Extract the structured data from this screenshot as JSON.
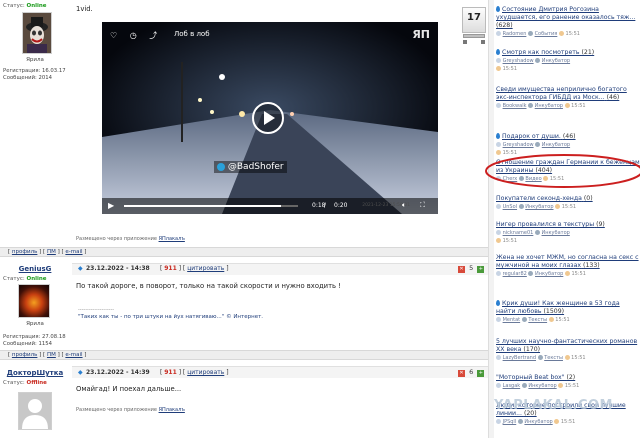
{
  "posts": [
    {
      "status_label": "Статус:",
      "status_value": "Online",
      "rank": "Ярила",
      "reg_label": "Регистрация:",
      "reg_date": "16.03.17",
      "msg_label": "Сообщений:",
      "msg_count": "2014",
      "body": "1vid.",
      "vote_count": "17",
      "via_text": "Размещено через приложение",
      "via_app": "ЯПлакалъ"
    },
    {
      "username": "GeniusG",
      "status_label": "Статус:",
      "status_value": "Online",
      "rank": "Ярила",
      "reg_label": "Регистрация:",
      "reg_date": "27.08.18",
      "msg_label": "Сообщений:",
      "msg_count": "1154",
      "date": "23.12.2022 - 14:38",
      "rating": "911",
      "quote": "цитировать",
      "score": "5",
      "body": "По такой дороге, в поворот, только на такой скорости и нужно входить !",
      "separator": "--------------------",
      "sig": "\"Таких как ты - по три штуки на йух натягиваю...\" © Интернет."
    },
    {
      "username": "ДокторШутка",
      "status_label": "Статус:",
      "status_value": "Offline",
      "date": "23.12.2022 - 14:39",
      "rating": "911",
      "quote": "цитировать",
      "score": "6",
      "body": "Омайгад! И поехал дальше...",
      "via_text": "Размещено через приложение",
      "via_app": "ЯПлакалъ"
    }
  ],
  "footer_links": [
    "профиль",
    "ПМ",
    "e-mail"
  ],
  "video": {
    "title": "Лоб в лоб",
    "logo": "ЯП",
    "channel": "@BadShofer",
    "time_current": "0:18",
    "time_total": "0:20",
    "timestamp": "2021-12-23 15:58:01"
  },
  "sidebar": [
    {
      "title": "Состояние Дмитрия Рогозина ухудшается, его ранение оказалось тяж...",
      "count": "(628)",
      "user": "Radomen",
      "category": "События",
      "time": "15:51",
      "drop": true
    },
    {
      "title": "Смотря как посмотреть",
      "count": "(21)",
      "user": "Greyshadow",
      "category": "Инкубатор",
      "time": "15:51",
      "drop": true
    },
    {
      "title": "Сведи имущества неприлично богатого экс-инспектора ГИБДД из Моск...",
      "count": "(46)",
      "user": "Bookwalk",
      "category": "Инкубатор",
      "time": "15:51",
      "drop": false
    },
    {
      "title": "Подарок от души.",
      "count": "(46)",
      "user": "Greyshadow",
      "category": "Инкубатор",
      "time": "15:51",
      "drop": true
    },
    {
      "title": "Отношение граждан Германии к беженцам из Украины",
      "count": "(404)",
      "user": "Cherx",
      "category": "Видео",
      "time": "15:51",
      "drop": false
    },
    {
      "title": "Покупатели секонд-хенда",
      "count": "(0)",
      "user": "UnSol",
      "category": "Инкубатор",
      "time": "15:51",
      "drop": false
    },
    {
      "title": "Нигер провалился в текстуры",
      "count": "(9)",
      "user": "nickname01",
      "category": "Инкубатор",
      "time": "15:51",
      "drop": false
    },
    {
      "title": "Жена не хочет МЖМ, но согласна на секс с мужчиной на моих глазах",
      "count": "(133)",
      "user": "regular82",
      "category": "Инкубатор",
      "time": "15:51",
      "drop": false
    },
    {
      "title": "Крик души! Как женщине в 53 года найти любовь",
      "count": "(1509)",
      "user": "Mentat",
      "category": "Тексты",
      "time": "15:51",
      "drop": true
    },
    {
      "title": "5 лучших научно-фантастических романов XX века",
      "count": "(170)",
      "user": "LazyBertrand",
      "category": "Тексты",
      "time": "15:51",
      "drop": false
    },
    {
      "title": "\"Моторный Beat box\"",
      "count": "(2)",
      "user": "Lasgak",
      "category": "Инкубатор",
      "time": "15:51",
      "drop": false
    },
    {
      "title": "Люди, которые построили свои лучшие линии...",
      "count": "(20)",
      "user": "JPSqll",
      "category": "Инкубатор",
      "time": "15:51",
      "drop": false
    }
  ],
  "watermark": "YAPLAKAL.COM",
  "colors": {
    "link": "#1f3d7a",
    "online": "#1a9a1a",
    "offline": "#c8281e",
    "circle": "#cc1f1f"
  }
}
